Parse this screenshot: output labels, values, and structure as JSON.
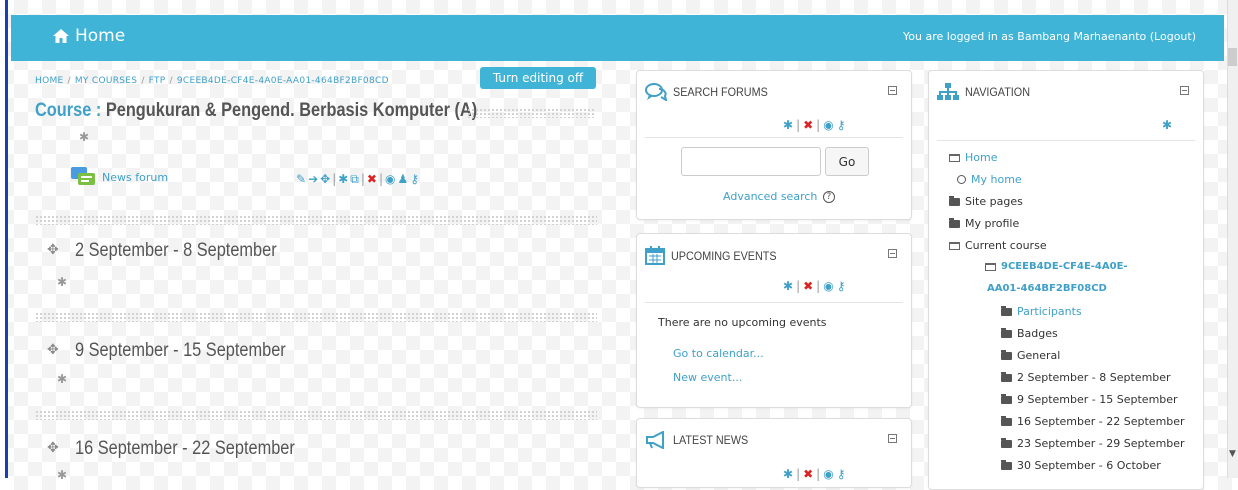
{
  "header": {
    "brand": "Home",
    "login_prefix": "You are logged in as",
    "user_name": "Bambang Marhaenanto",
    "logout": "(Logout)"
  },
  "breadcrumb": [
    "HOME",
    "MY COURSES",
    "FTP",
    "9CEEB4DE-CF4E-4A0E-AA01-464BF2BF08CD"
  ],
  "edit_button": "Turn editing off",
  "course": {
    "label": "Course",
    "separator": ":",
    "name": "Pengukuran & Pengend. Berbasis Komputer (A)",
    "forum": "News forum"
  },
  "sections": [
    "2 September - 8 September",
    "9 September - 15 September",
    "16 September - 22 September"
  ],
  "search_block": {
    "title": "SEARCH FORUMS",
    "go": "Go",
    "advanced": "Advanced search"
  },
  "events_block": {
    "title": "UPCOMING EVENTS",
    "empty": "There are no upcoming events",
    "calendar_link": "Go to calendar...",
    "new_event_link": "New event..."
  },
  "news_block": {
    "title": "LATEST NEWS"
  },
  "nav_block": {
    "title": "NAVIGATION",
    "items": [
      "Home",
      "My home",
      "Site pages",
      "My profile",
      "Current course",
      "9CEEB4DE-CF4E-4A0E-",
      "AA01-464BF2BF08CD",
      "Participants",
      "Badges",
      "General",
      "2 September - 8 September",
      "9 September - 15 September",
      "16 September - 22 September",
      "23 September - 29 September",
      "30 September - 6 October"
    ]
  },
  "colors": {
    "header_bg": "#3fb4d6",
    "link": "#3fa0c8",
    "delete": "#dd2222"
  }
}
